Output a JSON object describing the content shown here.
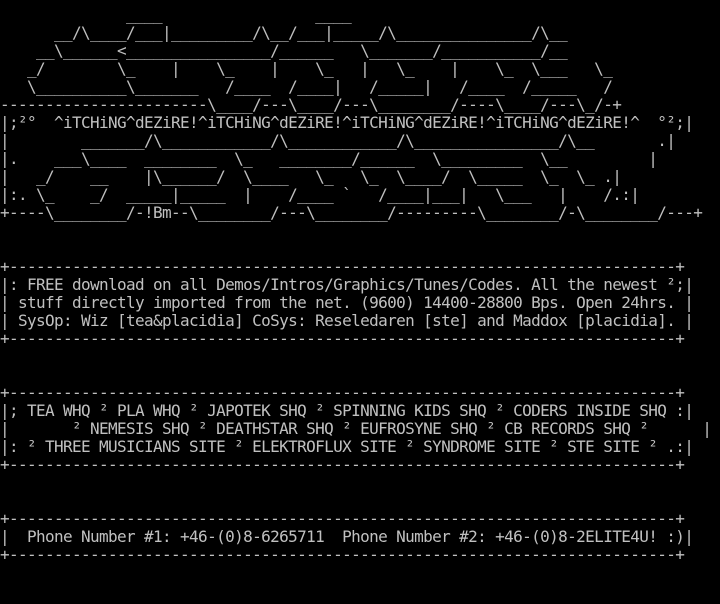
{
  "colors": {
    "background": "#000000",
    "text": "#c0c0c0"
  },
  "screen": {
    "lines": [
      "              ____                 ____",
      "      __/\\____/___|_________/\\__/___|_____/\\_______________/\\__",
      "    __\\______<________________/______   \\_______/___________/__",
      "   _/        \\_    |    \\_    |    \\_   |   \\_    |    \\_  \\___   \\_",
      "   \\__________\\_______   /____  /____|   /_____|   /____  /_____   /",
      "-----------------------\\____/---\\____/---\\________/----\\____/---\\_/-+",
      "|;²°  ^iTCHiNG^dEZiRE!^iTCHiNG^dEZiRE!^iTCHiNG^dEZiRE!^iTCHiNG^dEZiRE!^  °²;|",
      "|        _______/\\____________/\\____________/\\________________/\\__       .|",
      "|.    ___\\____  ________  \\_   ________/______  \\_________  \\__         |",
      "|   _/    __    |\\______/  \\____   \\_   \\_  \\____/  \\_____  \\_  \\_ .|",
      "|:. \\_    _/  _____|_____  |    /____ `   /____|___|   \\___   |    /.:|",
      "+----\\________/-!Bm--\\________/---\\________/---------\\________/-\\________/---+",
      "",
      "",
      "+--------------------------------------------------------------------------+",
      "|: FREE download on all Demos/Intros/Graphics/Tunes/Codes. All the newest ²;|",
      "| stuff directly imported from the net. (9600) 14400-28800 Bps. Open 24hrs. |",
      "| SysOp: Wiz [tea&placidia] CoSys: Reseledaren [ste] and Maddox [placidia]. |",
      "+--------------------------------------------------------------------------+",
      "",
      "",
      "+--------------------------------------------------------------------------+",
      "|; TEA WHQ ² PLA WHQ ² JAPOTEK SHQ ² SPINNING KIDS SHQ ² CODERS INSIDE SHQ :|",
      "|       ² NEMESIS SHQ ² DEATHSTAR SHQ ² EUFROSYNE SHQ ² CB RECORDS SHQ ²      |",
      "|: ² THREE MUSICIANS SITE ² ELEKTROFLUX SITE ² SYNDROME SITE ² STE SITE ² .:|",
      "+--------------------------------------------------------------------------+",
      "",
      "",
      "+--------------------------------------------------------------------------+",
      "|  Phone Number #1: +46-(0)8-6265711  Phone Number #2: +46-(0)8-2ELITE4U! :)|",
      "+--------------------------------------------------------------------------+"
    ]
  }
}
